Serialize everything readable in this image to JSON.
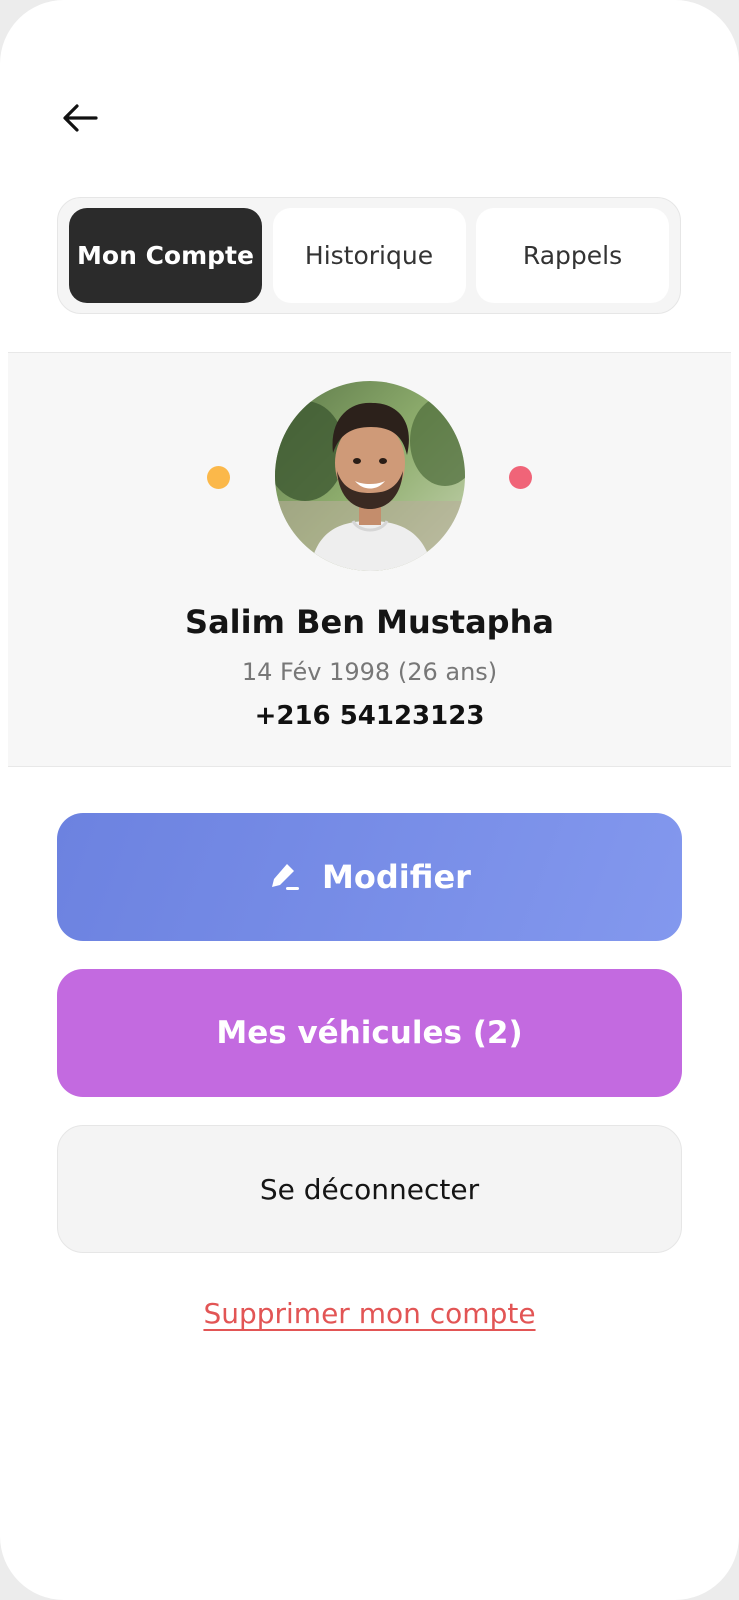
{
  "tabs": [
    {
      "label": "Mon Compte",
      "active": true
    },
    {
      "label": "Historique",
      "active": false
    },
    {
      "label": "Rappels",
      "active": false
    }
  ],
  "profile": {
    "name": "Salim Ben Mustapha",
    "dob": "14 Fév 1998 (26 ans)",
    "phone": "+216 54123123",
    "dot_left_color": "#fbb84a",
    "dot_right_color": "#f06478"
  },
  "actions": {
    "edit_label": "Modifier",
    "vehicles_label": "Mes véhicules (2)",
    "logout_label": "Se déconnecter",
    "delete_label": "Supprimer mon compte"
  },
  "icons": {
    "back": "arrow-left-icon",
    "edit": "pencil-icon"
  },
  "colors": {
    "edit_button": "#7386e6",
    "vehicles_button": "#c36ae0",
    "delete_link": "#e25555"
  }
}
